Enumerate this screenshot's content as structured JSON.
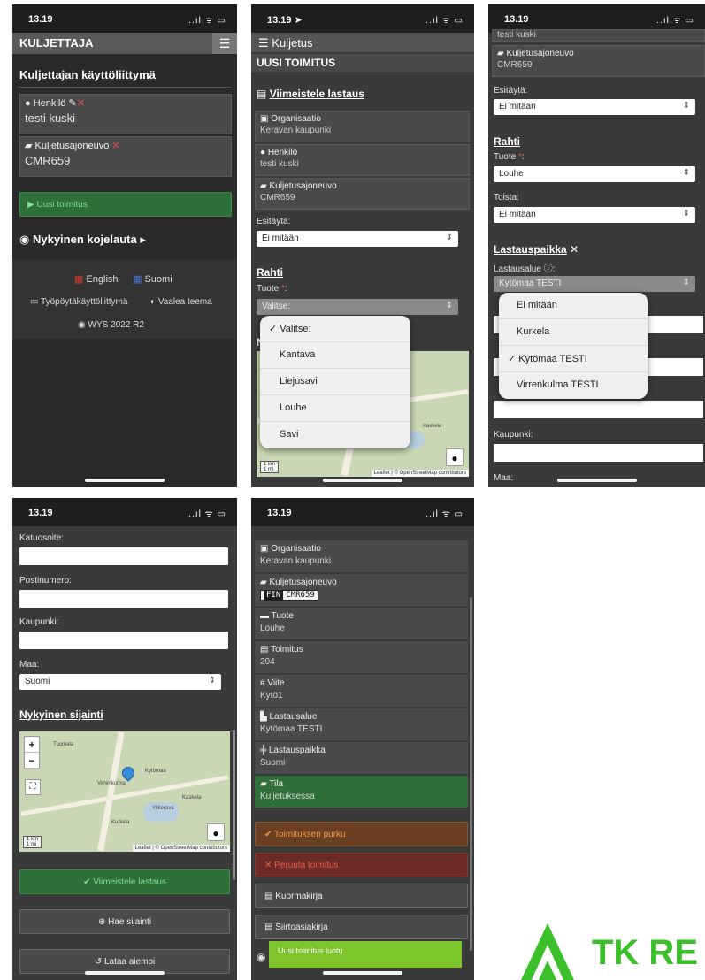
{
  "status": {
    "time": "13.19",
    "time_nav": "13.19 ➤",
    "signal": "..ıl ᯤ ▭"
  },
  "s1": {
    "brand": "KULJETTAJA",
    "menu_icon": "hamburger-icon",
    "title": "Kuljettajan käyttöliittymä",
    "person_label": "Henkilö",
    "person_value": "testi kuski",
    "vehicle_label": "Kuljetusajoneuvo",
    "vehicle_value": "CMR659",
    "new_delivery": "Uusi toimitus",
    "dashboard": "Nykyinen kojelauta",
    "lang_en": "English",
    "lang_fi": "Suomi",
    "desktop_ui": "Työpöytäkäyttöliittymä",
    "light_theme": "Vaalea teema",
    "version": "WYS 2022 R2"
  },
  "s2": {
    "nav": "Kuljetus",
    "subtitle": "UUSI TOIMITUS",
    "heading": "Viimeistele lastaus",
    "org_label": "Organisaatio",
    "org_value": "Keravan kaupunki",
    "person_label": "Henkilö",
    "person_value": "testi kuski",
    "vehicle_label": "Kuljetusajoneuvo",
    "vehicle_value": "CMR659",
    "prefill_label": "Esitäytä:",
    "prefill_value": "Ei mitään",
    "cargo_title": "Rahti",
    "product_label": "Tuote",
    "product_value": "Valitse:",
    "hidden_letter": "N",
    "options": [
      "✓ Valitse:",
      "Kantava",
      "Liejusavi",
      "Louhe",
      "Savi"
    ],
    "map_scale_km": "1 km",
    "map_scale_mi": "1 mi",
    "map_attrib": "Leaflet | © OpenStreetMap contributors",
    "map_place": "Kaskela"
  },
  "s3": {
    "top_person": "testi kuski",
    "vehicle_label": "Kuljetusajoneuvo",
    "vehicle_value": "CMR659",
    "prefill_label": "Esitäytä:",
    "prefill_value": "Ei mitään",
    "cargo_title": "Rahti",
    "product_label": "Tuote",
    "product_value": "Louhe",
    "repeat_label": "Toista:",
    "repeat_value": "Ei mitään",
    "loading_title": "Lastauspaikka",
    "area_label": "Lastausalue",
    "area_value": "Kytömaa TESTI",
    "options": [
      "Ei mitään",
      "Kurkela",
      "✓ Kytömaa TESTI",
      "Virrenkulma TESTI"
    ],
    "city_label": "Kaupunki:",
    "country_label": "Maa:"
  },
  "s4": {
    "street_label": "Katuosoite:",
    "postal_label": "Postinumero:",
    "city_label": "Kaupunki:",
    "country_label": "Maa:",
    "country_value": "Suomi",
    "location_title": "Nykyinen sijainti",
    "zoom_in": "+",
    "zoom_out": "−",
    "places": [
      "Tuomala",
      "Virrenkulma",
      "Kytömaa",
      "Ylikerava",
      "Kaskela",
      "Kurkela"
    ],
    "map_scale_km": "1 km",
    "map_scale_mi": "1 mi",
    "map_attrib": "Leaflet | © OpenStreetMap contributors",
    "finish_loading": "Viimeistele lastaus",
    "get_location": "Hae sijainti",
    "load_earlier": "Lataa aiempi"
  },
  "s5": {
    "rows": [
      {
        "label": "Organisaatio",
        "value": "Keravan kaupunki",
        "icon": "building-icon"
      },
      {
        "label": "Kuljetusajoneuvo",
        "value": "CMR659",
        "icon": "truck-icon"
      },
      {
        "label": "Tuote",
        "value": "Louhe",
        "icon": "box-icon"
      },
      {
        "label": "Toimitus",
        "value": "204",
        "icon": "file-icon"
      },
      {
        "label": "Viite",
        "value": "Kytö1",
        "icon": "hash-icon"
      },
      {
        "label": "Lastausalue",
        "value": "Kytömaa TESTI",
        "icon": "loader-icon"
      },
      {
        "label": "Lastauspaikka",
        "value": "Suomi",
        "icon": "signpost-icon"
      },
      {
        "label": "Tila",
        "value": "Kuljetuksessa",
        "icon": "truck-icon"
      }
    ],
    "plate_country": "FIN",
    "unload": "Toimituksen purku",
    "cancel": "Peruuta toimitus",
    "waybill": "Kuormakirja",
    "transfer_doc": "Siirtoasiakirja",
    "toast": "Uusi toimitus luotu"
  },
  "logo": {
    "text": "TK RE",
    "color": "#3bbf2a"
  }
}
